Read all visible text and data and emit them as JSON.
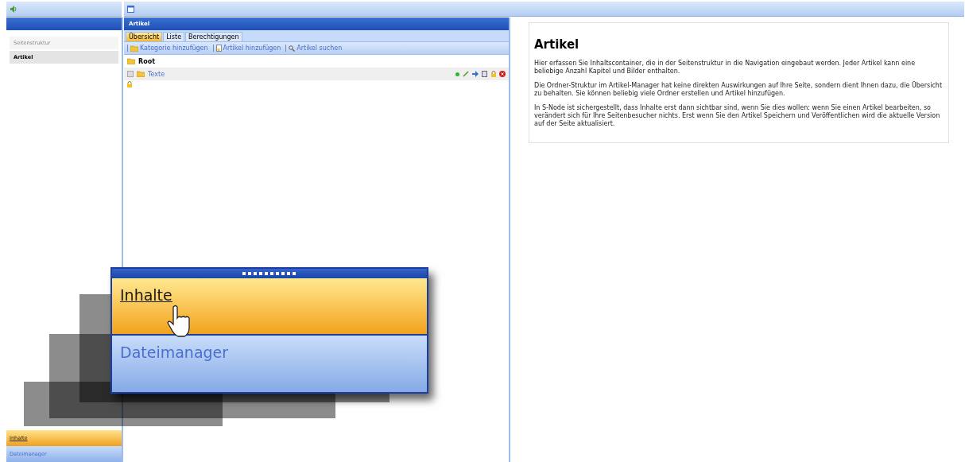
{
  "sidebar": {
    "items": [
      {
        "label": "Seitenstruktur",
        "selected": false
      },
      {
        "label": "Artikel",
        "selected": true
      }
    ],
    "sections": [
      {
        "label": "Inhalte",
        "selected": true
      },
      {
        "label": "Dateimanager",
        "selected": false
      }
    ]
  },
  "panel": {
    "title": "Artikel",
    "tabs": [
      {
        "label": "Übersicht",
        "selected": true
      },
      {
        "label": "Liste",
        "selected": false
      },
      {
        "label": "Berechtigungen",
        "selected": false
      }
    ],
    "toolbar": [
      {
        "label": "Kategorie hinzufügen",
        "kind": "folder"
      },
      {
        "label": "Artikel hinzufügen",
        "kind": "page"
      },
      {
        "label": "Artikel suchen",
        "kind": "search"
      }
    ],
    "tree": [
      {
        "label": "Root",
        "children": [
          {
            "label": "Texte",
            "expanded": false
          }
        ]
      }
    ]
  },
  "info": {
    "title": "Artikel",
    "paragraphs": [
      "Hier erfassen Sie Inhaltscontainer, die in der Seitenstruktur in die Navigation eingebaut werden. Jeder Artikel kann eine beliebige Anzahl Kapitel und Bilder enthalten.",
      "Die Ordner-Struktur im Artikel-Manager hat keine direkten Auswirkungen auf Ihre Seite, sondern dient Ihnen dazu, die Übersicht zu behalten. Sie können beliebig viele Ordner erstellen und Artikel hinzufügen.",
      "In S-Node ist sichergestellt, dass Inhalte erst dann sichtbar sind, wenn Sie dies wollen: wenn Sie einen Artikel bearbeiten, so verändert sich für Ihre Seitenbesucher nichts. Erst wenn Sie den Artikel Speichern und Veröffentlichen wird die aktuelle Version auf der Seite aktualisiert."
    ]
  },
  "zoom_menu": {
    "items": [
      {
        "label": "Inhalte",
        "selected": true
      },
      {
        "label": "Dateimanager",
        "selected": false
      }
    ]
  }
}
